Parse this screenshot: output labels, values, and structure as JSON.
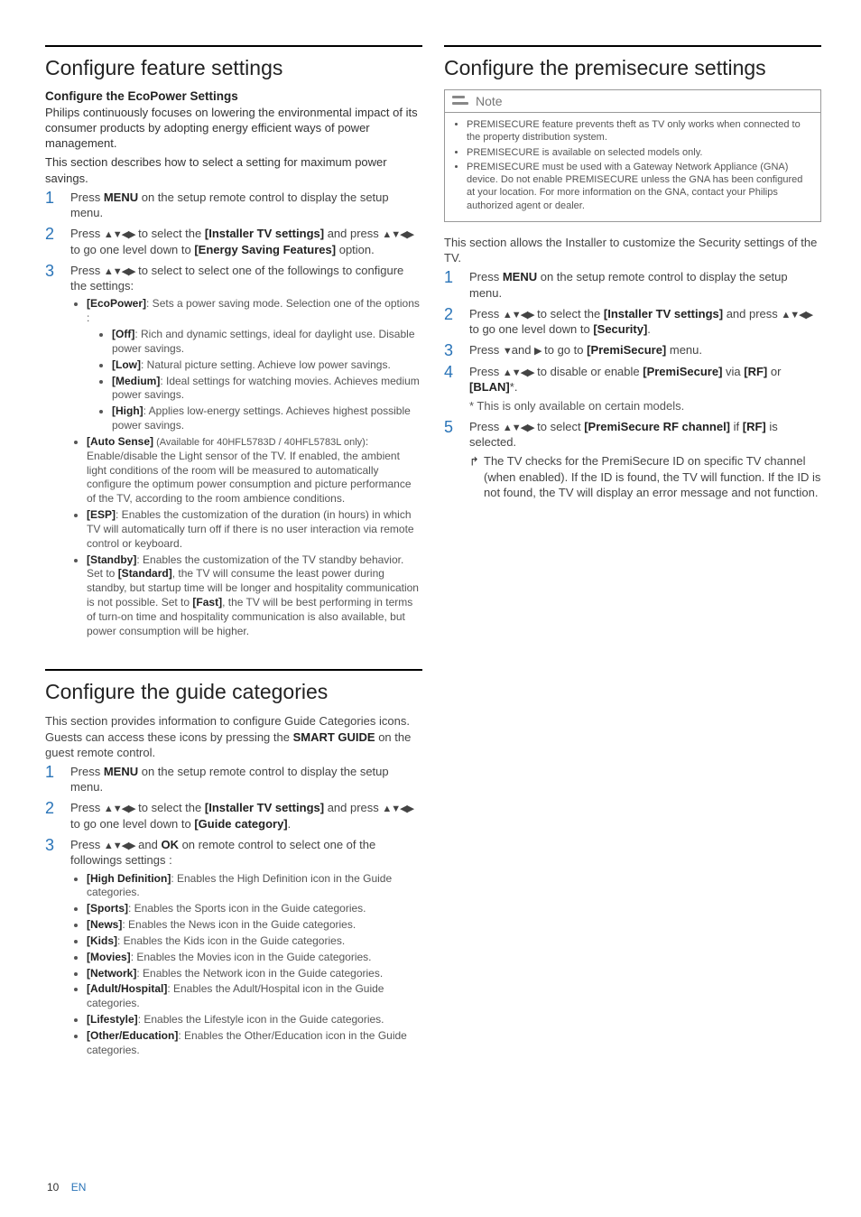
{
  "page": {
    "number": "10",
    "lang": "EN"
  },
  "arrows": "▲▼◀▶",
  "left": {
    "s1": {
      "heading": "Configure feature settings",
      "sub": "Configure the EcoPower Settings",
      "p1": "Philips continuously focuses on lowering the environmental impact of its consumer products by adopting energy efficient ways of power management.",
      "p2": "This section describes how to select a setting for maximum power savings.",
      "step1a": "Press ",
      "step1b": "MENU",
      "step1c": " on the setup remote control to display the setup menu.",
      "step2a": "Press ",
      "step2b": " to select the ",
      "step2c": "[Installer TV settings]",
      "step2d": " and press ",
      "step2e": " to go one level down to ",
      "step2f": "[Energy Saving Features]",
      "step2g": " option.",
      "step3a": "Press ",
      "step3b": " to select to select one of the followings to configure the settings:",
      "eco_l": "[EcoPower]",
      "eco_t": ": Sets a power saving mode. Selection one of the options :",
      "off_l": "[Off]",
      "off_t": ": Rich and dynamic settings, ideal for daylight use. Disable power savings.",
      "low_l": "[Low]",
      "low_t": ": Natural picture setting. Achieve low power savings.",
      "med_l": "[Medium]",
      "med_t": ": Ideal settings for watching movies. Achieves medium power savings.",
      "high_l": "[High]",
      "high_t": ": Applies low-energy settings. Achieves highest possible power savings.",
      "auto_l": "[Auto Sense]",
      "auto_n": " (Available for 40HFL5783D / 40HFL5783L only)",
      "auto_t": ": Enable/disable the Light sensor of the TV. If enabled, the ambient light conditions of the room will be measured to automatically configure the optimum power consumption and picture performance of the TV, according to the room ambience conditions.",
      "esp_l": "[ESP]",
      "esp_t": ": Enables the customization of the duration (in hours) in which TV will automatically turn off if there is no user interaction via remote control or keyboard.",
      "stb_l": "[Standby]",
      "stb_t1": ": Enables the customization of the TV standby behavior. Set to ",
      "stb_std": "[Standard]",
      "stb_t2": ", the TV will consume the least power during standby, but startup time will be longer and hospitality communication is not possible. Set to ",
      "stb_fast": "[Fast]",
      "stb_t3": ", the TV will be best performing in terms of turn-on time and hospitality communication is also available, but power consumption will be higher."
    },
    "s2": {
      "heading": "Configure the guide categories",
      "p1a": "This section provides information to configure Guide Categories icons. Guests can access these icons by pressing the ",
      "p1b": "SMART GUIDE",
      "p1c": " on the guest remote control.",
      "step1a": "Press ",
      "step1b": "MENU",
      "step1c": " on the setup remote control to display the setup menu.",
      "step2a": "Press ",
      "step2b": " to select the ",
      "step2c": "[Installer TV settings]",
      "step2d": " and press ",
      "step2e": " to go one level down to ",
      "step2f": "[Guide category]",
      "step2g": ".",
      "step3a": "Press ",
      "step3b": " and ",
      "step3c": "OK",
      "step3d": " on remote control to select one of the followings settings :",
      "hd_l": "[High Definition]",
      "hd_t": ": Enables the High Definition icon in the Guide categories.",
      "sp_l": "[Sports]",
      "sp_t": ": Enables the Sports icon in the Guide categories.",
      "nw_l": "[News]",
      "nw_t": ": Enables the News icon in the Guide categories.",
      "kd_l": "[Kids]",
      "kd_t": ": Enables the Kids icon in the Guide categories.",
      "mv_l": "[Movies]",
      "mv_t": ": Enables the Movies icon in the Guide categories.",
      "net_l": "[Network]",
      "net_t": ": Enables the Network icon in the Guide categories.",
      "ah_l": "[Adult/Hospital]",
      "ah_t": ": Enables the Adult/Hospital icon in the Guide categories.",
      "ls_l": "[Lifestyle]",
      "ls_t": ": Enables the Lifestyle icon in the Guide categories.",
      "oe_l": "[Other/Education]",
      "oe_t": ": Enables the Other/Education icon in the Guide categories."
    }
  },
  "right": {
    "heading": "Configure the premisecure settings",
    "note_label": "Note",
    "n1": "PREMISECURE feature prevents theft as TV only works when connected to the property distribution system.",
    "n2": "PREMISECURE is available on selected models only.",
    "n3": "PREMISECURE must be used with a Gateway Network Appliance (GNA) device. Do not enable PREMISECURE unless the GNA has been configured at your location. For more information on the GNA, contact your Philips authorized agent or dealer.",
    "intro": "This section allows the Installer to customize the Security settings of the TV.",
    "step1a": "Press ",
    "step1b": "MENU",
    "step1c": " on the setup remote control to display the setup menu.",
    "step2a": "Press ",
    "step2b": " to select the ",
    "step2c": "[Installer TV settings]",
    "step2d": " and press ",
    "step2e": " to go one level down to ",
    "step2f": "[Security]",
    "step2g": ".",
    "step3a": "Press ",
    "step3b": "▼",
    "step3c": "and ",
    "step3d": "▶",
    "step3e": " to go to ",
    "step3f": "[PremiSecure]",
    "step3g": " menu.",
    "step4a": "Press ",
    "step4b": " to disable or enable ",
    "step4c": "[PremiSecure]",
    "step4d": " via ",
    "step4e": "[RF]",
    "step4f": " or ",
    "step4g": "[BLAN]",
    "step4h": "*.",
    "step4note": "* This is only available on certain models.",
    "step5a": "Press ",
    "step5b": " to select ",
    "step5c": "[PremiSecure RF channel]",
    "step5d": " if ",
    "step5e": "[RF]",
    "step5f": " is selected.",
    "result": "The TV checks for the PremiSecure ID on specific TV channel (when enabled). If the ID is found, the TV will function. If the ID is not found, the TV will display an error message and not function."
  }
}
